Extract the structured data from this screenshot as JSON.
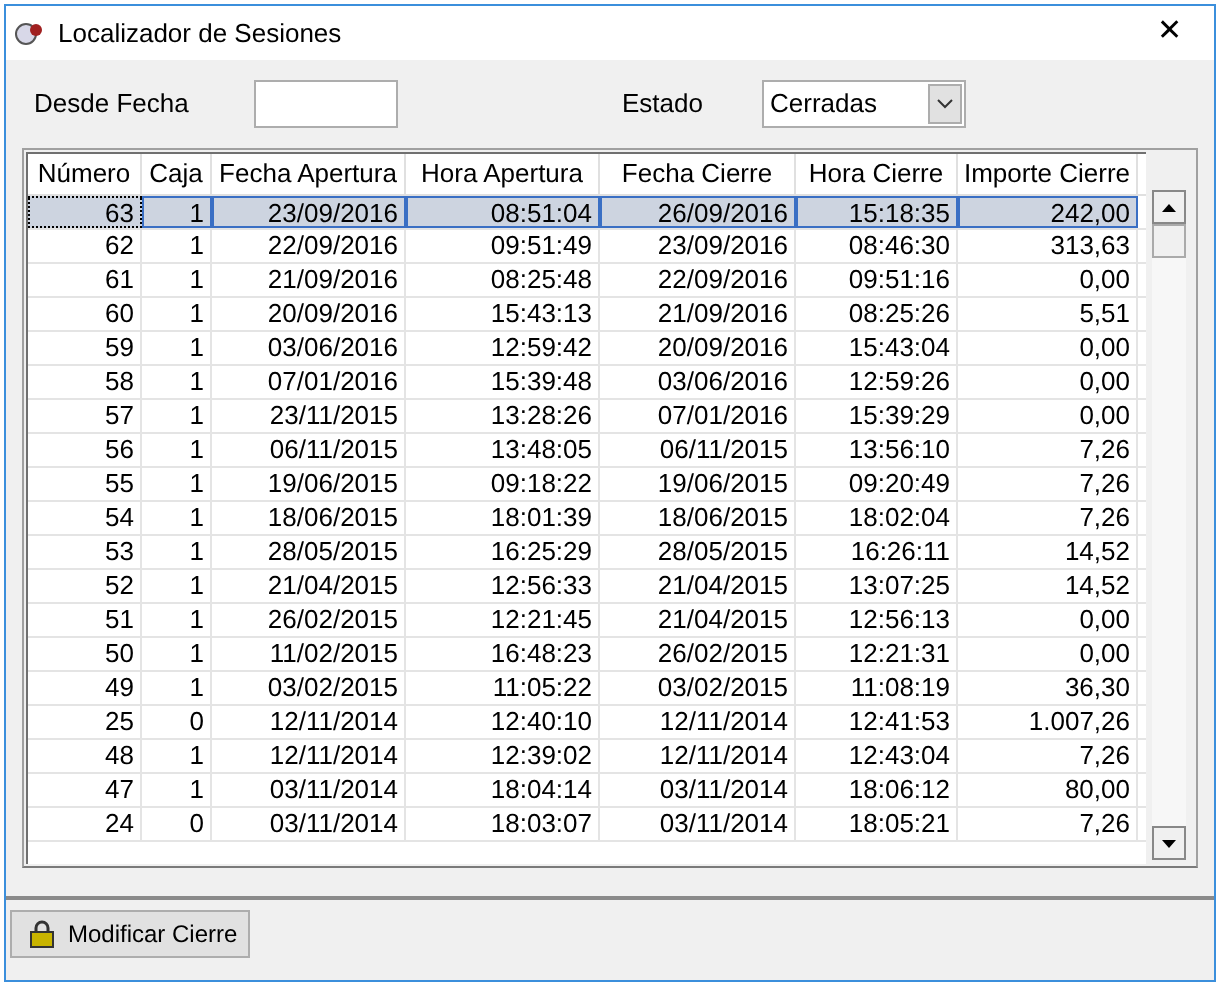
{
  "window": {
    "title": "Localizador de Sesiones",
    "close": "✕"
  },
  "filters": {
    "from_date": {
      "label": "Desde Fecha"
    },
    "state": {
      "label": "Estado",
      "value": "Cerradas"
    }
  },
  "table": {
    "columns": [
      "Número",
      "Caja",
      "Fecha Apertura",
      "Hora Apertura",
      "Fecha Cierre",
      "Hora Cierre",
      "Importe Cierre"
    ],
    "rows": [
      {
        "cells": [
          "63",
          "1",
          "23/09/2016",
          "08:51:04",
          "26/09/2016",
          "15:18:35",
          "242,00"
        ],
        "selected": true
      },
      {
        "cells": [
          "62",
          "1",
          "22/09/2016",
          "09:51:49",
          "23/09/2016",
          "08:46:30",
          "313,63"
        ],
        "selected": false
      },
      {
        "cells": [
          "61",
          "1",
          "21/09/2016",
          "08:25:48",
          "22/09/2016",
          "09:51:16",
          "0,00"
        ],
        "selected": false
      },
      {
        "cells": [
          "60",
          "1",
          "20/09/2016",
          "15:43:13",
          "21/09/2016",
          "08:25:26",
          "5,51"
        ],
        "selected": false
      },
      {
        "cells": [
          "59",
          "1",
          "03/06/2016",
          "12:59:42",
          "20/09/2016",
          "15:43:04",
          "0,00"
        ],
        "selected": false
      },
      {
        "cells": [
          "58",
          "1",
          "07/01/2016",
          "15:39:48",
          "03/06/2016",
          "12:59:26",
          "0,00"
        ],
        "selected": false
      },
      {
        "cells": [
          "57",
          "1",
          "23/11/2015",
          "13:28:26",
          "07/01/2016",
          "15:39:29",
          "0,00"
        ],
        "selected": false
      },
      {
        "cells": [
          "56",
          "1",
          "06/11/2015",
          "13:48:05",
          "06/11/2015",
          "13:56:10",
          "7,26"
        ],
        "selected": false
      },
      {
        "cells": [
          "55",
          "1",
          "19/06/2015",
          "09:18:22",
          "19/06/2015",
          "09:20:49",
          "7,26"
        ],
        "selected": false
      },
      {
        "cells": [
          "54",
          "1",
          "18/06/2015",
          "18:01:39",
          "18/06/2015",
          "18:02:04",
          "7,26"
        ],
        "selected": false
      },
      {
        "cells": [
          "53",
          "1",
          "28/05/2015",
          "16:25:29",
          "28/05/2015",
          "16:26:11",
          "14,52"
        ],
        "selected": false
      },
      {
        "cells": [
          "52",
          "1",
          "21/04/2015",
          "12:56:33",
          "21/04/2015",
          "13:07:25",
          "14,52"
        ],
        "selected": false
      },
      {
        "cells": [
          "51",
          "1",
          "26/02/2015",
          "12:21:45",
          "21/04/2015",
          "12:56:13",
          "0,00"
        ],
        "selected": false
      },
      {
        "cells": [
          "50",
          "1",
          "11/02/2015",
          "16:48:23",
          "26/02/2015",
          "12:21:31",
          "0,00"
        ],
        "selected": false
      },
      {
        "cells": [
          "49",
          "1",
          "03/02/2015",
          "11:05:22",
          "03/02/2015",
          "11:08:19",
          "36,30"
        ],
        "selected": false
      },
      {
        "cells": [
          "25",
          "0",
          "12/11/2014",
          "12:40:10",
          "12/11/2014",
          "12:41:53",
          "1.007,26"
        ],
        "selected": false
      },
      {
        "cells": [
          "48",
          "1",
          "12/11/2014",
          "12:39:02",
          "12/11/2014",
          "12:43:04",
          "7,26"
        ],
        "selected": false
      },
      {
        "cells": [
          "47",
          "1",
          "03/11/2014",
          "18:04:14",
          "03/11/2014",
          "18:06:12",
          "80,00"
        ],
        "selected": false
      },
      {
        "cells": [
          "24",
          "0",
          "03/11/2014",
          "18:03:07",
          "03/11/2014",
          "18:05:21",
          "7,26"
        ],
        "selected": false
      }
    ]
  },
  "buttons": [
    {
      "label": "Modificar Cierre"
    }
  ]
}
